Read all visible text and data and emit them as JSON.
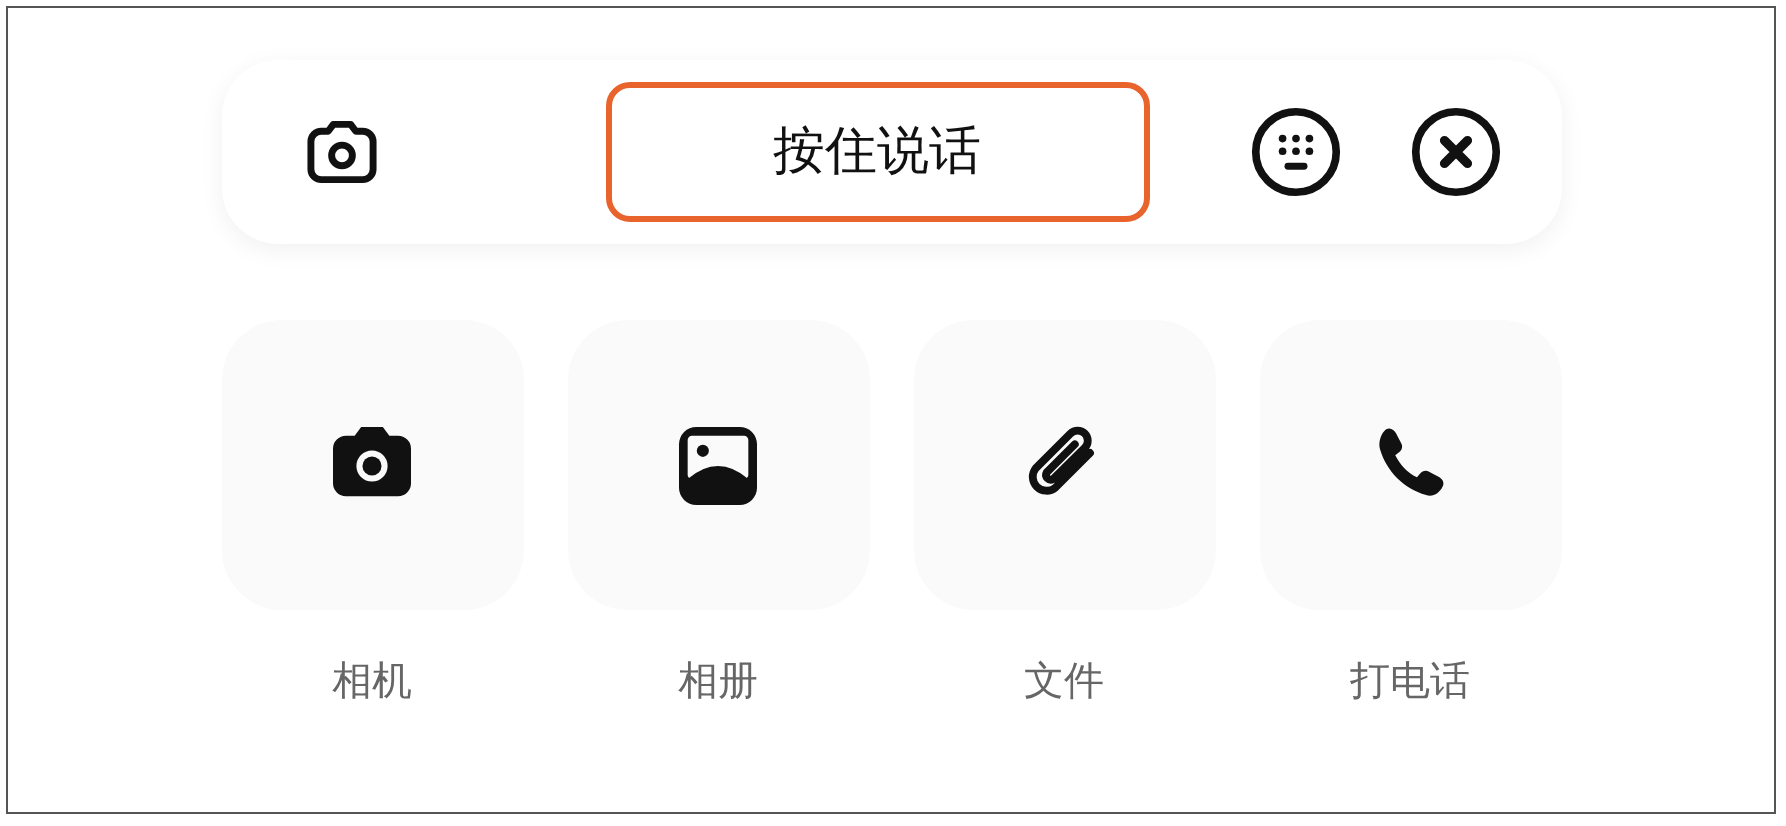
{
  "voice_bar": {
    "hold_to_talk": "按住说话"
  },
  "actions": [
    {
      "kind": "camera",
      "label": "相机"
    },
    {
      "kind": "album",
      "label": "相册"
    },
    {
      "kind": "file",
      "label": "文件"
    },
    {
      "kind": "phone",
      "label": "打电话"
    }
  ]
}
